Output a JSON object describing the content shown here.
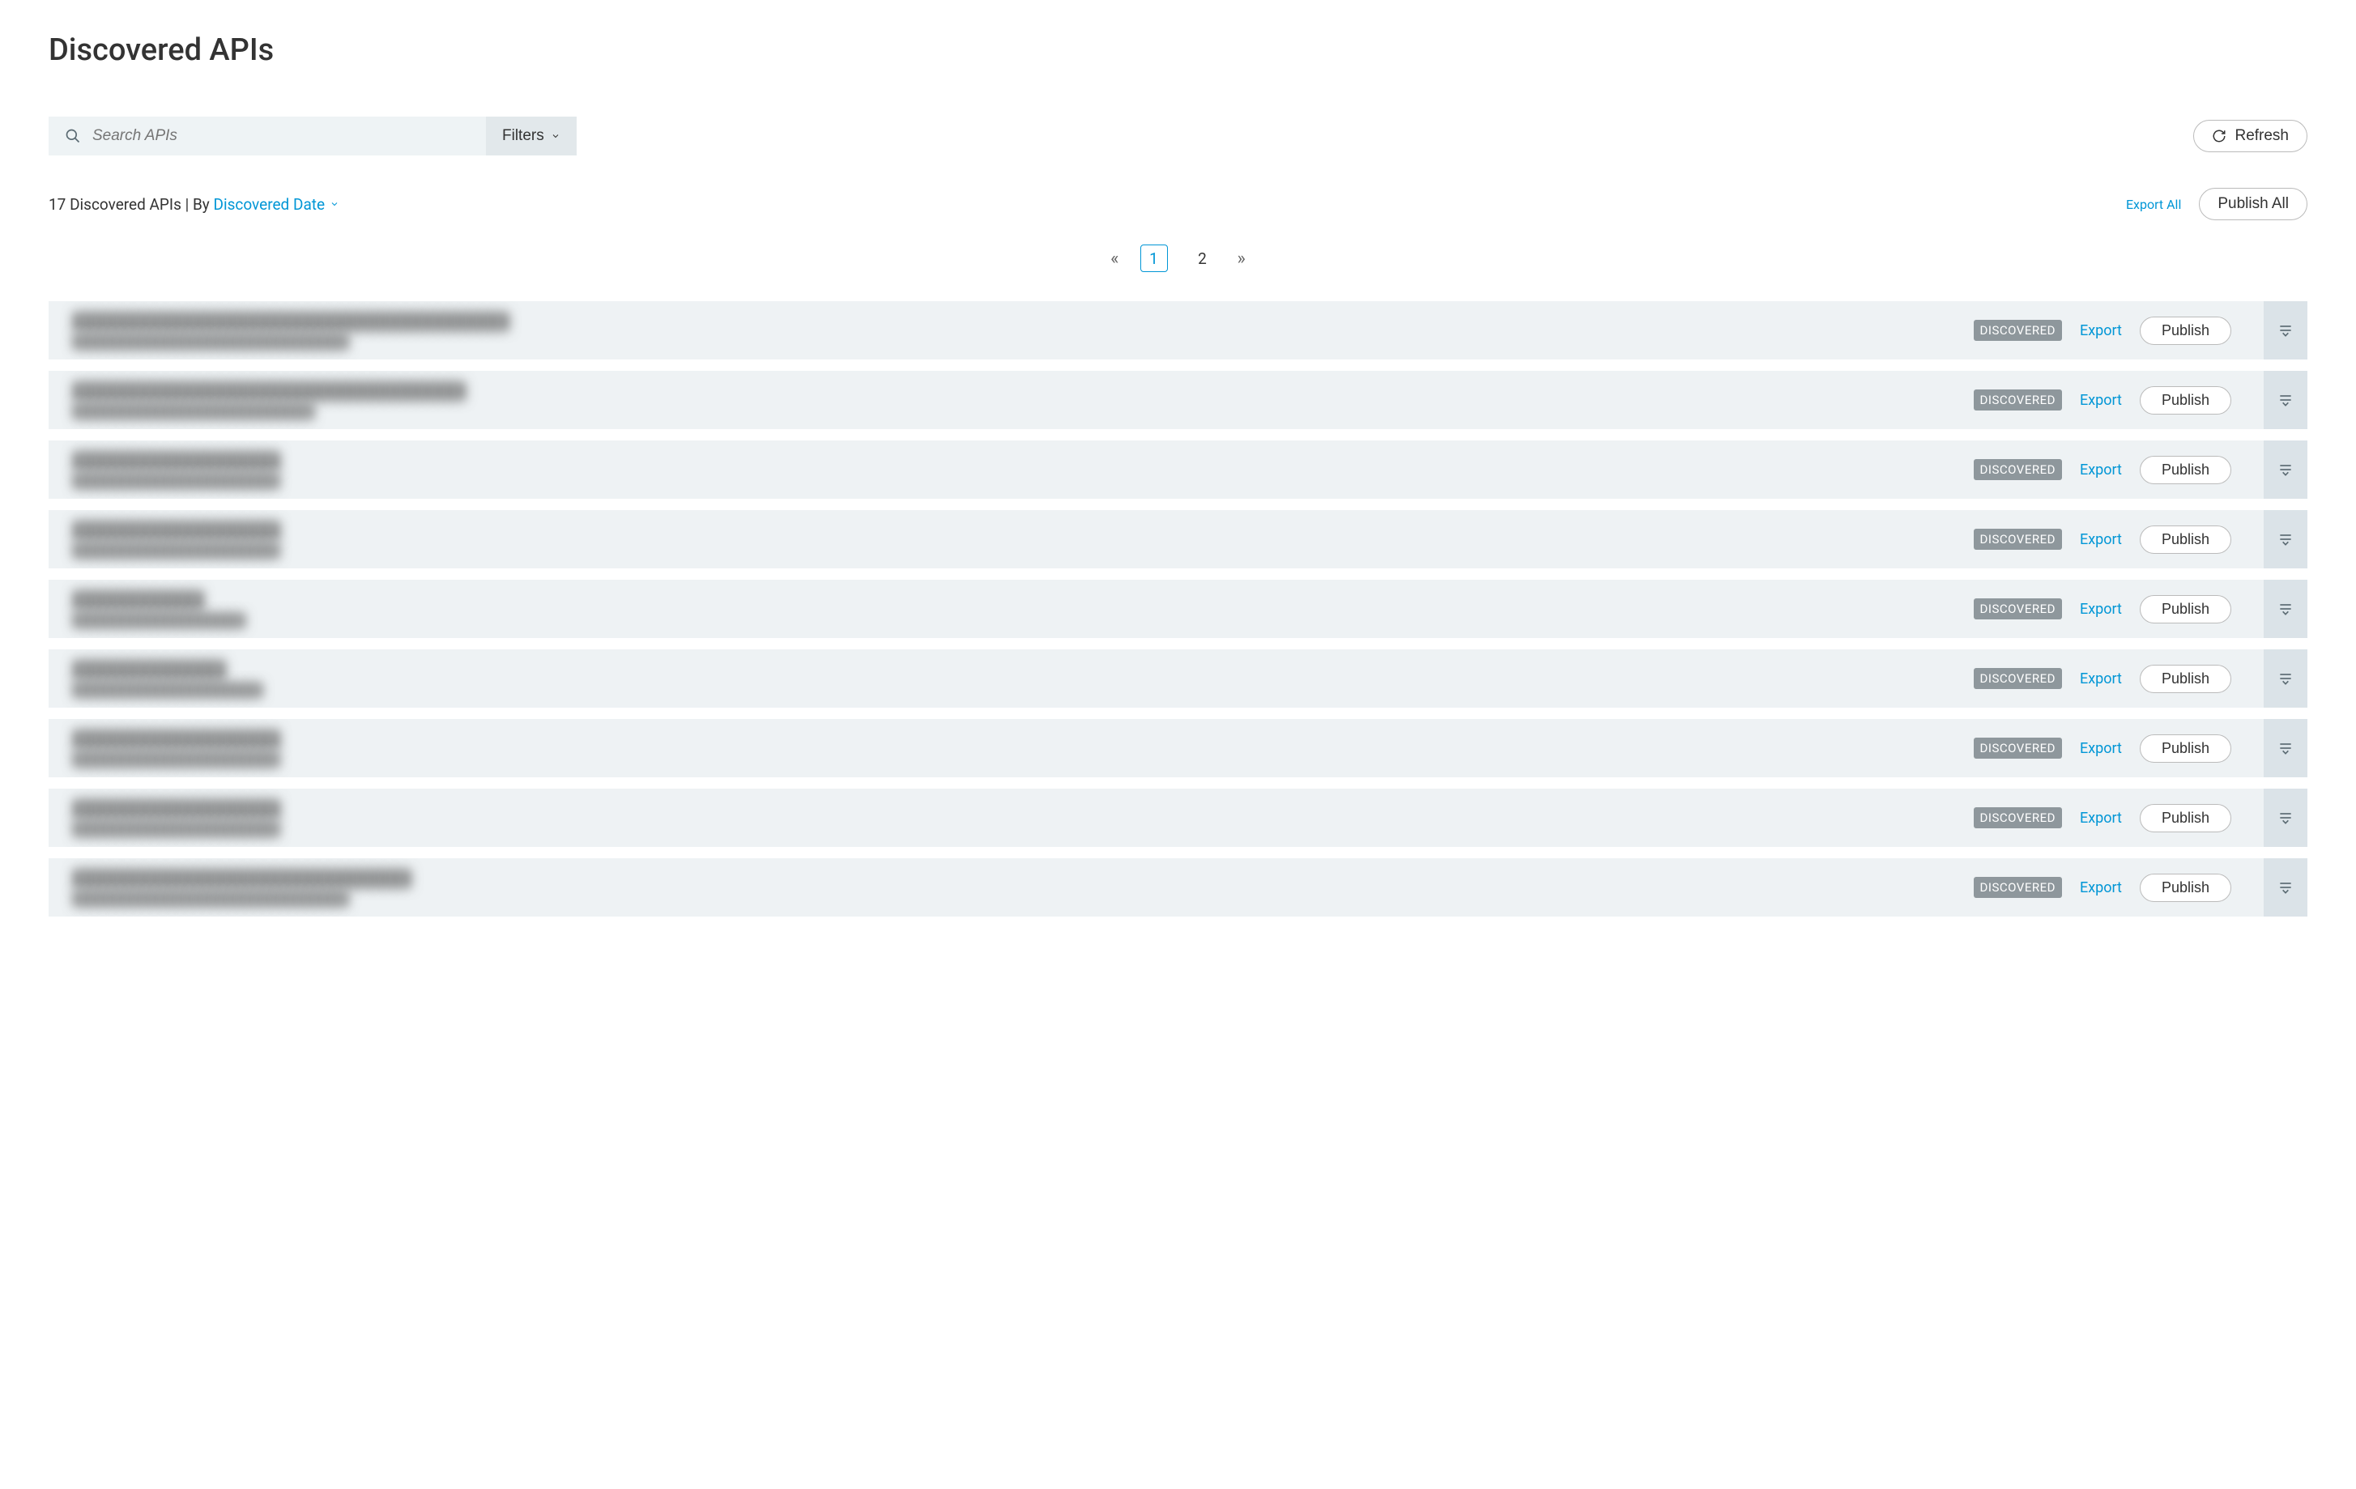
{
  "page": {
    "title": "Discovered APIs"
  },
  "search": {
    "placeholder": "Search APIs",
    "filters_label": "Filters"
  },
  "actions": {
    "refresh": "Refresh",
    "export_all": "Export All",
    "publish_all": "Publish All"
  },
  "meta": {
    "count_text": "17 Discovered APIs",
    "sort_prefix": "By",
    "sort_field": "Discovered Date"
  },
  "pagination": {
    "current": "1",
    "pages": [
      "1",
      "2"
    ]
  },
  "row_labels": {
    "status": "DISCOVERED",
    "export": "Export",
    "publish": "Publish"
  },
  "rows": [
    {
      "title": "████████████████████████████████████████",
      "subtitle": "████████████████████████████████"
    },
    {
      "title": "████████████████████████████████████",
      "subtitle": "████████████████████████████"
    },
    {
      "title": "███████████████████",
      "subtitle": "████████████████████████"
    },
    {
      "title": "███████████████████",
      "subtitle": "████████████████████████"
    },
    {
      "title": "████████████",
      "subtitle": "████████████████████"
    },
    {
      "title": "██████████████",
      "subtitle": "██████████████████████"
    },
    {
      "title": "███████████████████",
      "subtitle": "████████████████████████"
    },
    {
      "title": "███████████████████",
      "subtitle": "████████████████████████"
    },
    {
      "title": "███████████████████████████████",
      "subtitle": "████████████████████████████████"
    }
  ]
}
